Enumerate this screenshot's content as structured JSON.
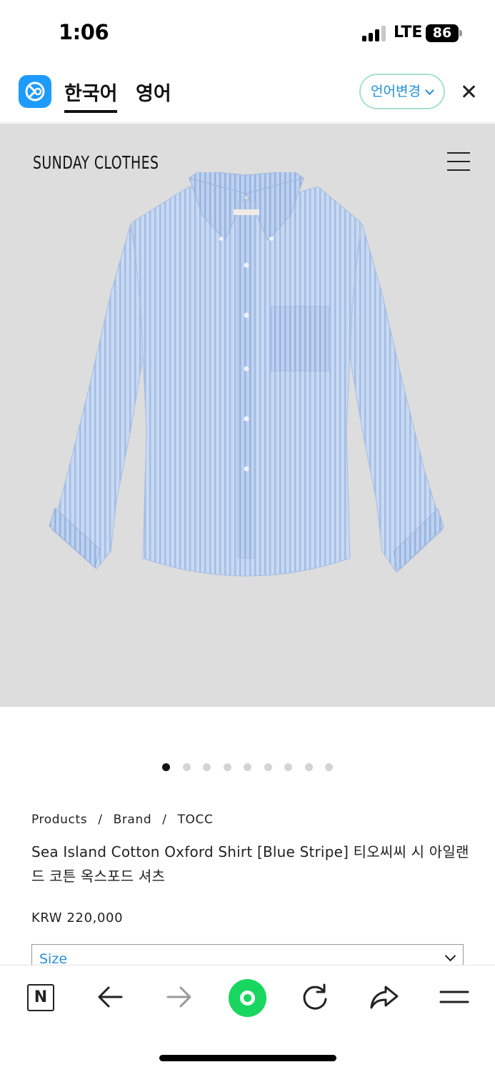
{
  "status_bar": {
    "time": "1:06",
    "network": "LTE",
    "battery": "86"
  },
  "translate_bar": {
    "tabs": [
      {
        "label": "한국어",
        "selected": true
      },
      {
        "label": "영어",
        "selected": false
      }
    ],
    "change_language_label": "언어변경",
    "close_icon": "close-icon",
    "accent_color": "#1f8fd7"
  },
  "hero": {
    "brand": "SUNDAY CLOTHES",
    "menu_icon": "hamburger-menu-icon",
    "image_subject": "blue striped oxford shirt",
    "carousel": {
      "count": 9,
      "active_index": 0
    }
  },
  "product": {
    "breadcrumb": [
      "Products",
      "Brand",
      "TOCC"
    ],
    "name": "Sea Island Cotton Oxford Shirt [Blue Stripe] 티오씨씨 시 아일랜드 코튼 옥스포드 셔츠",
    "price": "KRW 220,000",
    "size_select": {
      "label": "Size"
    }
  },
  "browser_bar": {
    "items": [
      "naver-n-icon",
      "back-arrow-icon",
      "forward-arrow-icon",
      "green-home-button",
      "reload-icon",
      "share-icon",
      "menu-icon"
    ],
    "green_color": "#18d65f"
  }
}
